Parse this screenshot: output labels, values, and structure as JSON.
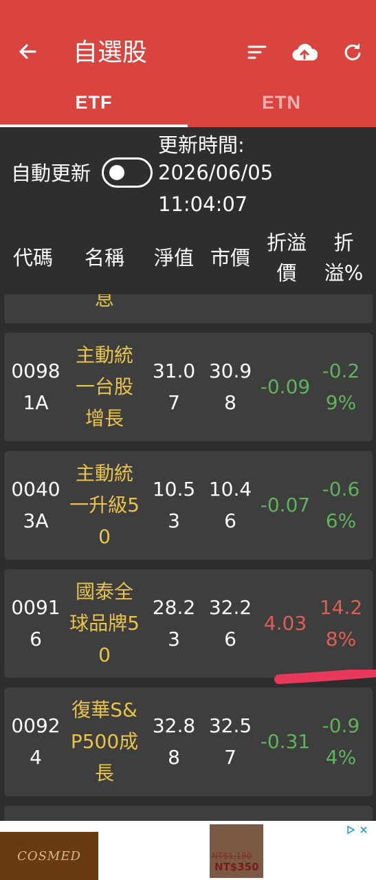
{
  "appbar": {
    "title": "自選股",
    "back_icon": "arrow-left",
    "sort_icon": "sort-lines",
    "upload_icon": "cloud-upload",
    "refresh_icon": "refresh"
  },
  "tabs": [
    {
      "label": "ETF",
      "active": true
    },
    {
      "label": "ETN",
      "active": false
    }
  ],
  "controls": {
    "auto_update_label": "自動更新",
    "auto_update_on": false,
    "update_time_label": "更新時間:",
    "update_date": "2026/06/05",
    "update_time": "11:04:07"
  },
  "columns": {
    "code": "代碼",
    "name": "名稱",
    "nav": "淨值",
    "price": "市價",
    "diff_line1": "折溢",
    "diff_line2": "價",
    "pct_line1": "折",
    "pct_line2": "溢%"
  },
  "partial_row": {
    "name_tail": "息"
  },
  "rows": [
    {
      "code": "00981A",
      "name": "主動統一台股增長",
      "nav": "31.07",
      "price": "30.98",
      "diff": "-0.09",
      "pct": "-0.29%",
      "trend": "down"
    },
    {
      "code": "00403A",
      "name": "主動統一升級50",
      "nav": "10.53",
      "price": "10.46",
      "diff": "-0.07",
      "pct": "-0.66%",
      "trend": "down"
    },
    {
      "code": "00916",
      "name": "國泰全球品牌50",
      "nav": "28.23",
      "price": "32.26",
      "diff": "4.03",
      "pct": "14.28%",
      "trend": "up"
    },
    {
      "code": "00924",
      "name": "復華S&P500成長",
      "nav": "32.88",
      "price": "32.57",
      "diff": "-0.31",
      "pct": "-0.94%",
      "trend": "down"
    }
  ],
  "ad": {
    "brand": "COSMED",
    "price_old": "NT$1,180",
    "price_new": "NT$350"
  },
  "colors": {
    "appbar": "#d9443f",
    "background": "#2e2e2e",
    "card": "#3e3e3e",
    "name": "#e8c44a",
    "negative": "#5fb35a",
    "positive": "#e05f54"
  }
}
